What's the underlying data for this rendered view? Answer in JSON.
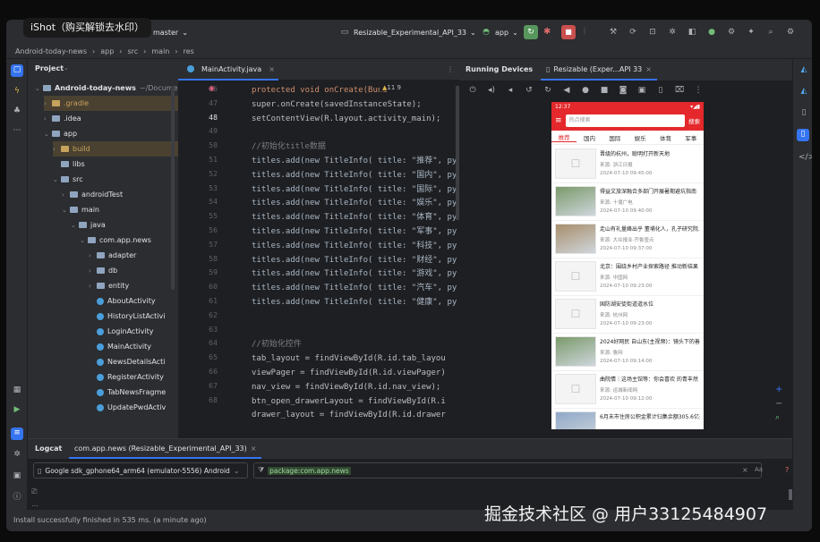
{
  "watermark_top": "iShot（购买解锁去水印）",
  "watermark_bottom": "掘金技术社区 @ 用户3312548490​7",
  "titlebar": {
    "branch": "master",
    "run_config": "Resizable_Experimental_API_33",
    "module": "app"
  },
  "breadcrumbs": [
    "Android-today-news",
    "app",
    "src",
    "main",
    "res"
  ],
  "project": {
    "title": "Project",
    "rows": [
      {
        "label": "Android-today-news",
        "suffix": "~/Docume",
        "kind": "folder",
        "indent": 0
      },
      {
        "label": ".gradle",
        "kind": "folder",
        "indent": 1
      },
      {
        "label": ".idea",
        "kind": "folder",
        "indent": 1
      },
      {
        "label": "app",
        "kind": "folder",
        "indent": 1
      },
      {
        "label": "build",
        "kind": "folder",
        "indent": 2
      },
      {
        "label": "libs",
        "kind": "folder",
        "indent": 2
      },
      {
        "label": "src",
        "kind": "folder",
        "indent": 2
      },
      {
        "label": "androidTest",
        "kind": "folder",
        "indent": 3
      },
      {
        "label": "main",
        "kind": "folder",
        "indent": 3
      },
      {
        "label": "java",
        "kind": "folder",
        "indent": 4
      },
      {
        "label": "com.app.news",
        "kind": "folder",
        "indent": 5
      },
      {
        "label": "adapter",
        "kind": "folder",
        "indent": 6
      },
      {
        "label": "db",
        "kind": "folder",
        "indent": 6
      },
      {
        "label": "entity",
        "kind": "folder",
        "indent": 6
      },
      {
        "label": "AboutActivity",
        "kind": "class",
        "indent": 6
      },
      {
        "label": "HistoryListActivi",
        "kind": "class",
        "indent": 6
      },
      {
        "label": "LoginActivity",
        "kind": "class",
        "indent": 6
      },
      {
        "label": "MainActivity",
        "kind": "class",
        "indent": 6
      },
      {
        "label": "NewsDetailsActi",
        "kind": "class",
        "indent": 6
      },
      {
        "label": "RegisterActivity",
        "kind": "class",
        "indent": 6
      },
      {
        "label": "TabNewsFragme",
        "kind": "class",
        "indent": 6
      },
      {
        "label": "UpdatePwdActiv",
        "kind": "class",
        "indent": 6
      }
    ]
  },
  "editor": {
    "tab": "MainActivity.java",
    "inspections": "11  9",
    "line_numbers": [
      "46",
      "47",
      "48",
      "49",
      "50",
      "51",
      "52",
      "53",
      "54",
      "55",
      "56",
      "57",
      "58",
      "59",
      "60",
      "61",
      "62",
      "63",
      "64",
      "65",
      "66",
      "67",
      "68"
    ],
    "lines": [
      "protected void onCreate(Bund",
      "    super.onCreate(savedInstanceState);",
      "    setContentView(R.layout.activity_main);",
      "",
      "    //初始化title数据",
      "    titles.add(new TitleInfo( title: \"推荐\",  py",
      "    titles.add(new TitleInfo( title: \"国内\",  py",
      "    titles.add(new TitleInfo( title: \"国际\",  py",
      "    titles.add(new TitleInfo( title: \"娱乐\",  py",
      "    titles.add(new TitleInfo( title: \"体育\",  py",
      "    titles.add(new TitleInfo( title: \"军事\",  py",
      "    titles.add(new TitleInfo( title: \"科技\",  py",
      "    titles.add(new TitleInfo( title: \"财经\",  py",
      "    titles.add(new TitleInfo( title: \"游戏\",  py",
      "    titles.add(new TitleInfo( title: \"汽车\",  py",
      "    titles.add(new TitleInfo( title: \"健康\",  py",
      "",
      "",
      "    //初始化控件",
      "    tab_layout = findViewById(R.id.tab_layou",
      "    viewPager = findViewById(R.id.viewPager)",
      "    nav_view = findViewById(R.id.nav_view);",
      "    btn_open_drawerLayout = findViewById(R.i",
      "    drawer_layout = findViewById(R.id.drawer"
    ]
  },
  "devices": {
    "title": "Running Devices",
    "tab": "Resizable (Exper...API 33"
  },
  "phone": {
    "time": "12:37",
    "search_placeholder": "热点搜索",
    "search_btn": "搜索",
    "tabs": [
      "推荐",
      "国内",
      "国际",
      "娱乐",
      "体育",
      "军事"
    ],
    "news": [
      {
        "title": "晋级的杭州，聪明打开新天地",
        "source": "来源: 浙江日报",
        "time": "2024-07-10 09:45:00",
        "image": false
      },
      {
        "title": "得益文旅深融合多部门开展暑期避坑指南",
        "source": "来源: 十堰广电",
        "time": "2024-07-10 09:40:00",
        "image": true
      },
      {
        "title": "走山有礼量峰出乎 董埔化人，孔子研究院...",
        "source": "来源: 大众报业·齐鲁壹点",
        "time": "2024-07-10 09:37:00",
        "image": true
      },
      {
        "title": "北京：围绕乡村产业探索路径 推动新结果",
        "source": "来源: 中国网",
        "time": "2024-07-10 09:23:00",
        "image": false
      },
      {
        "title": "国防湖安徒街道道水位",
        "source": "来源: 杭州网",
        "time": "2024-07-10 09:23:00",
        "image": false
      },
      {
        "title": "2024好网民 自山东(主视频)：镜头下的善...",
        "source": "来源: 鲁网",
        "time": "2024-07-10 09:14:00",
        "image": true
      },
      {
        "title": "曲院情｜这场主馆等：你会喜欢 的青丰然",
        "source": "来源: 运城新闻网",
        "time": "2024-07-10 09:12:00",
        "image": false
      },
      {
        "title": "6月末市住房公积金累计归集余额305.6亿元",
        "source": "",
        "time": "",
        "image": true
      }
    ]
  },
  "logcat": {
    "tab1": "Logcat",
    "tab2": "com.app.news (Resizable_Experimental_API_33)",
    "device": "Google sdk_gphone64_arm64 (emulator-5556) Android",
    "filter": "package:com.app.news"
  },
  "status": {
    "message": "Install successfully finished in 535 ms. (a minute ago)"
  },
  "colors": {
    "accent": "#e4282b",
    "ide_bg": "#1e1f22",
    "panel_bg": "#2b2d30"
  }
}
